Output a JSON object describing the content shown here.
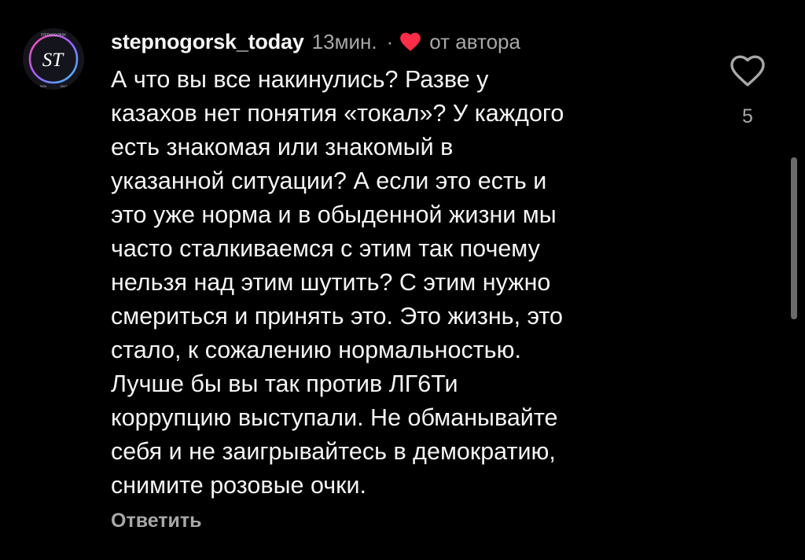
{
  "comment": {
    "username": "stepnogorsk_today",
    "time": "13мин.",
    "separator": "·",
    "author_label": "от автора",
    "body_lines": [
      "А что вы все накинулись? Разве у",
      "казахов нет понятия «токал»? У каждого",
      "есть знакомая или знакомый в",
      "указанной ситуации? А если это есть и",
      "это уже норма и в обыденной жизни мы",
      "часто сталкиваемся с этим так почему",
      "нельзя над этим шутить? С этим нужно",
      "смериться и принять это. Это жизнь, это",
      "стало, к сожалению нормальностью.",
      "Лучше бы вы так против ЛГ6Ти",
      "коррупцию выступали. Не обманывайте",
      "себя и не заигрывайтесь в демократию,",
      "снимите розовые очки."
    ],
    "reply_label": "Ответить",
    "like_count": "5"
  },
  "avatar": {
    "monogram": "ST",
    "top_text": "STEPNOGORSK",
    "bottom_left": "NOV",
    "bottom_right": "2017"
  },
  "icons": {
    "author_heart": "heart-filled-icon",
    "like": "heart-outline-icon"
  },
  "colors": {
    "background": "#000000",
    "text_primary": "#f5f5f5",
    "text_secondary": "#a8a8a8",
    "heart_red": "#ff2d46",
    "scrollbar": "#6a6a6a",
    "avatar_gradient": [
      "#ff4fa8",
      "#9b5cff",
      "#38c7ff"
    ]
  }
}
